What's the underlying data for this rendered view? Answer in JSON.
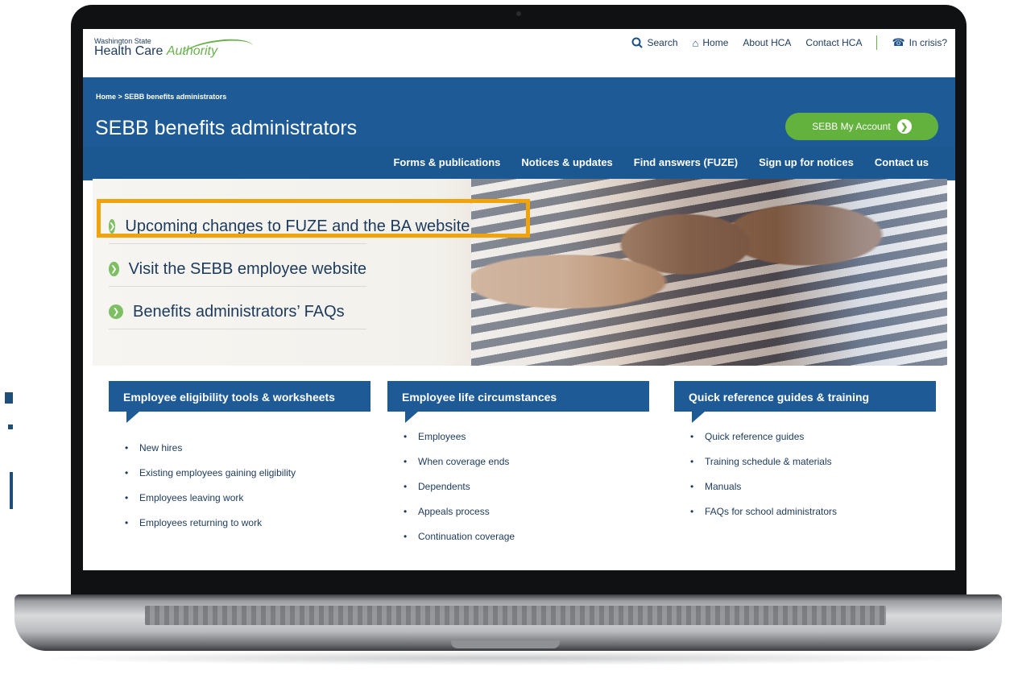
{
  "header": {
    "logo_small": "Washington State",
    "logo_big_a": "Health Care ",
    "logo_big_b": "Authority",
    "links": [
      {
        "icon": "search-icon",
        "label": "Search"
      },
      {
        "icon": "home-icon",
        "label": "Home"
      },
      {
        "label": "About HCA"
      },
      {
        "label": "Contact HCA"
      },
      {
        "icon": "phone-icon",
        "label": "In crisis?"
      }
    ]
  },
  "hero": {
    "breadcrumb": "Home  >  SEBB benefits administrators",
    "title": "SEBB benefits administrators",
    "account_button": "SEBB My Account"
  },
  "nav": [
    "Forms & publications",
    "Notices & updates",
    "Find answers (FUZE)",
    "Sign up for notices",
    "Contact us"
  ],
  "banner_links": [
    "Upcoming changes to FUZE and the BA website",
    "Visit the SEBB employee website",
    "Benefits administrators’ FAQs"
  ],
  "columns": [
    {
      "title": "Employee eligibility tools & worksheets",
      "items": [
        "New hires",
        "Existing employees gaining eligibility",
        "Employees leaving work",
        "Employees returning to work"
      ]
    },
    {
      "title": "Employee life circumstances",
      "items": [
        "Employees",
        "When coverage ends",
        "Dependents",
        "Appeals process",
        "Continuation coverage"
      ]
    },
    {
      "title": "Quick reference guides & training",
      "items": [
        "Quick reference guides",
        "Training schedule & materials",
        "Manuals",
        "FAQs for school administrators"
      ]
    }
  ],
  "colors": {
    "brand_blue": "#1e5b96",
    "accent_green": "#63b23d",
    "highlight": "#f0a30a"
  }
}
